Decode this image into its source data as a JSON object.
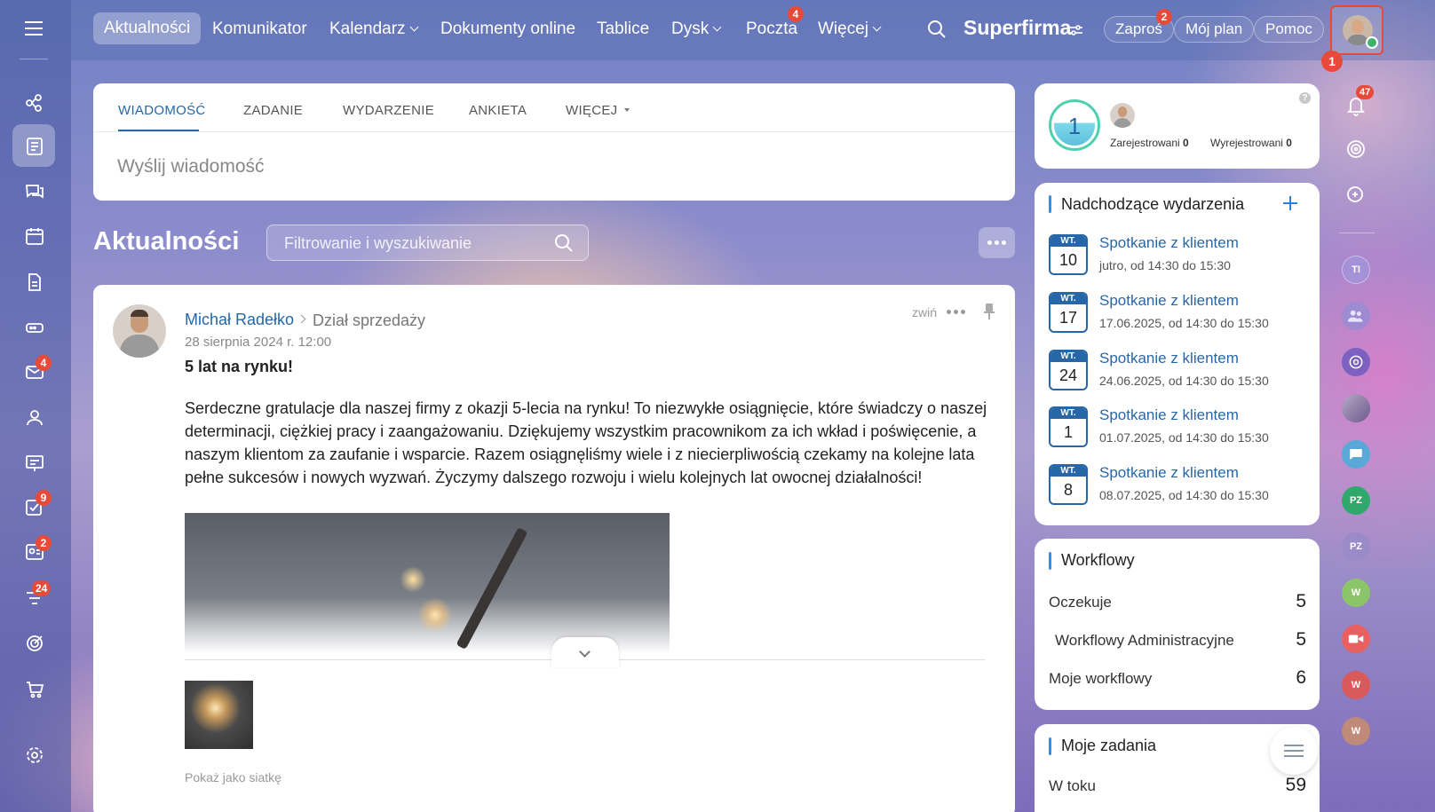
{
  "nav": {
    "items": [
      {
        "label": "Aktualności"
      },
      {
        "label": "Komunikator"
      },
      {
        "label": "Kalendarz"
      },
      {
        "label": "Dokumenty online"
      },
      {
        "label": "Tablice"
      },
      {
        "label": "Dysk"
      },
      {
        "label": "Poczta"
      },
      {
        "label": "Więcej"
      }
    ],
    "poczta_badge": "4",
    "company": "Superfirma",
    "invite": "Zaproś",
    "invite_badge": "2",
    "plan": "Mój plan",
    "help": "Pomoc",
    "avatar_badge": "1",
    "notif_badge": "47"
  },
  "sidebar": {
    "mail_badge": "4",
    "tasks_badge": "9",
    "crm_badge": "2",
    "feed_badge": "24"
  },
  "composer": {
    "tabs": [
      "WIADOMOŚĆ",
      "ZADANIE",
      "WYDARZENIE",
      "ANKIETA",
      "WIĘCEJ"
    ],
    "placeholder": "Wyślij wiadomość"
  },
  "feed": {
    "title": "Aktualności",
    "filter_placeholder": "Filtrowanie i wyszukiwanie"
  },
  "post": {
    "author": "Michał Radełko",
    "dept": "Dział sprzedaży",
    "date": "28 sierpnia 2024 r. 12:00",
    "collapse": "zwiń",
    "title": "5 lat na rynku!",
    "body": "Serdeczne gratulacje dla naszej firmy z okazji 5-lecia na rynku! To niezwykłe osiągnięcie, które świadczy o naszej determinacji, ciężkiej pracy i zaangażowaniu. Dziękujemy wszystkim pracownikom za ich wkład i poświęcenie, a naszym klientom za zaufanie i wsparcie. Razem osiągnęliśmy wiele i z niecierpliwością czekamy na kolejne lata pełne sukcesów i nowych wyzwań. Życzymy dalszego rozwoju i wielu kolejnych lat owocnej działalności!",
    "grid_link": "Pokaż jako siatkę"
  },
  "presence": {
    "count": "1",
    "registered_label": "Zarejestrowani",
    "registered": "0",
    "unregistered_label": "Wyrejestrowani",
    "unregistered": "0"
  },
  "events": {
    "title": "Nadchodzące wydarzenia",
    "items": [
      {
        "dow": "WT.",
        "day": "10",
        "title": "Spotkanie z klientem",
        "time": "jutro, od 14:30 do 15:30"
      },
      {
        "dow": "WT.",
        "day": "17",
        "title": "Spotkanie z klientem",
        "time": "17.06.2025, od 14:30 do 15:30"
      },
      {
        "dow": "WT.",
        "day": "24",
        "title": "Spotkanie z klientem",
        "time": "24.06.2025, od 14:30 do 15:30"
      },
      {
        "dow": "WT.",
        "day": "1",
        "title": "Spotkanie z klientem",
        "time": "01.07.2025, od 14:30 do 15:30"
      },
      {
        "dow": "WT.",
        "day": "8",
        "title": "Spotkanie z klientem",
        "time": "08.07.2025, od 14:30 do 15:30"
      }
    ]
  },
  "workflows": {
    "title": "Workflowy",
    "rows": [
      {
        "label": "Oczekuje",
        "value": "5"
      },
      {
        "label": "Workflowy Administracyjne",
        "value": "5"
      },
      {
        "label": "Moje workflowy",
        "value": "6"
      }
    ]
  },
  "tasks": {
    "title": "Moje zadania",
    "row_label": "W toku",
    "row_value": "59"
  },
  "rightbar": {
    "avatars": [
      "TI",
      "PZ",
      "PZ",
      "W",
      "W",
      "W"
    ]
  }
}
